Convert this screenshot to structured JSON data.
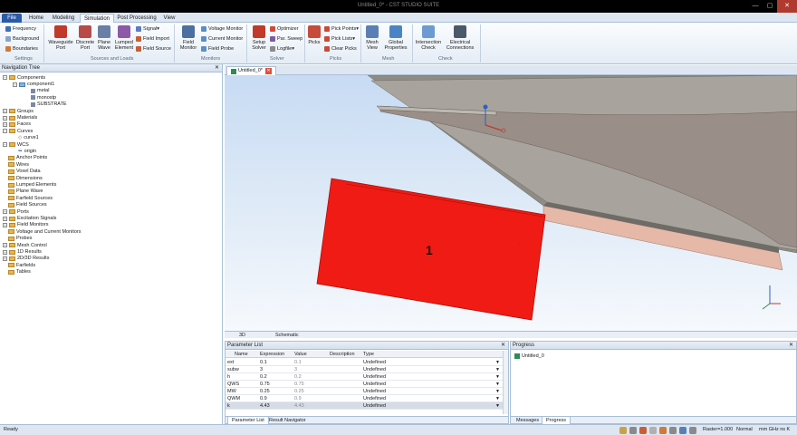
{
  "window": {
    "title": "Untitled_0* - CST STUDIO SUITE"
  },
  "tabs": [
    {
      "label": "File"
    },
    {
      "label": "Home"
    },
    {
      "label": "Modeling"
    },
    {
      "label": "Simulation"
    },
    {
      "label": "Post Processing"
    },
    {
      "label": "View"
    }
  ],
  "ribbon": {
    "settings": {
      "frequency": "Frequency",
      "background": "Background",
      "boundaries": "Boundaries",
      "group": "Settings"
    },
    "sources": {
      "waveguide_port": "Waveguide Port",
      "discrete_port": "Discrete Port",
      "plane_wave": "Plane Wave",
      "lumped_element": "Lumped Element",
      "signal": "Signal",
      "field_import": "Field Import",
      "field_source": "Field Source",
      "group": "Sources and Loads"
    },
    "monitors": {
      "field_monitor": "Field Monitor",
      "voltage_monitor": "Voltage Monitor",
      "current_monitor": "Current Monitor",
      "field_probe": "Field Probe",
      "group": "Monitors"
    },
    "solver": {
      "setup_solver": "Setup Solver",
      "optimizer": "Optimizer",
      "par_sweep": "Par. Sweep",
      "logfile": "Logfile",
      "group": "Solver"
    },
    "picks": {
      "picks": "Picks",
      "pick_points": "Pick Points",
      "pick_lists": "Pick Lists",
      "clear_picks": "Clear Picks",
      "group": "Picks"
    },
    "mesh": {
      "mesh_view": "Mesh View",
      "global_properties": "Global Properties",
      "group": "Mesh"
    },
    "check": {
      "intersection_check": "Intersection Check",
      "electrical_connections": "Electrical Connections",
      "group": "Check"
    }
  },
  "nav": {
    "title": "Navigation Tree",
    "items": [
      {
        "label": "Components"
      },
      {
        "label": "component1"
      },
      {
        "label": "metal"
      },
      {
        "label": "monostp"
      },
      {
        "label": "SUBSTRATE"
      },
      {
        "label": "Groups"
      },
      {
        "label": "Materials"
      },
      {
        "label": "Faces"
      },
      {
        "label": "Curves"
      },
      {
        "label": "curve1"
      },
      {
        "label": "WCS"
      },
      {
        "label": "origin"
      },
      {
        "label": "Anchor Points"
      },
      {
        "label": "Wires"
      },
      {
        "label": "Voxel Data"
      },
      {
        "label": "Dimensions"
      },
      {
        "label": "Lumped Elements"
      },
      {
        "label": "Plane Wave"
      },
      {
        "label": "Farfield Sources"
      },
      {
        "label": "Field Sources"
      },
      {
        "label": "Ports"
      },
      {
        "label": "Excitation Signals"
      },
      {
        "label": "Field Monitors"
      },
      {
        "label": "Voltage and Current Monitors"
      },
      {
        "label": "Probes"
      },
      {
        "label": "Mesh Control"
      },
      {
        "label": "1D Results"
      },
      {
        "label": "2D/3D Results"
      },
      {
        "label": "Farfields"
      },
      {
        "label": "Tables"
      }
    ]
  },
  "document": {
    "tab": "Untitled_0*",
    "port_label": "1"
  },
  "view_tabs": [
    {
      "label": "3D"
    },
    {
      "label": "Schematic"
    }
  ],
  "params": {
    "title": "Parameter List",
    "headers": {
      "name": "Name",
      "expression": "Expression",
      "value": "Value",
      "description": "Description",
      "type": "Type"
    },
    "rows": [
      {
        "name": "ext",
        "expression": "0.1",
        "value": "0.1",
        "type": "Undefined"
      },
      {
        "name": "subw",
        "expression": "3",
        "value": "3",
        "type": "Undefined"
      },
      {
        "name": "h",
        "expression": "0.2",
        "value": "0.2",
        "type": "Undefined"
      },
      {
        "name": "QWS",
        "expression": "0.75",
        "value": "0.75",
        "type": "Undefined"
      },
      {
        "name": "MW",
        "expression": "0.25",
        "value": "0.25",
        "type": "Undefined"
      },
      {
        "name": "QWM",
        "expression": "0.9",
        "value": "0.9",
        "type": "Undefined"
      },
      {
        "name": "k",
        "expression": "4.43",
        "value": "4.43",
        "type": "Undefined"
      }
    ],
    "tabs": [
      {
        "label": "Parameter List"
      },
      {
        "label": "Result Navigator"
      }
    ]
  },
  "progress": {
    "title": "Progress",
    "entry": "Untitled_0",
    "tabs": [
      {
        "label": "Messages"
      },
      {
        "label": "Progress"
      }
    ]
  },
  "status": {
    "ready": "Ready",
    "raster": "Raster=1.000",
    "mode": "Normal",
    "units": "mm  GHz  ns  K"
  }
}
